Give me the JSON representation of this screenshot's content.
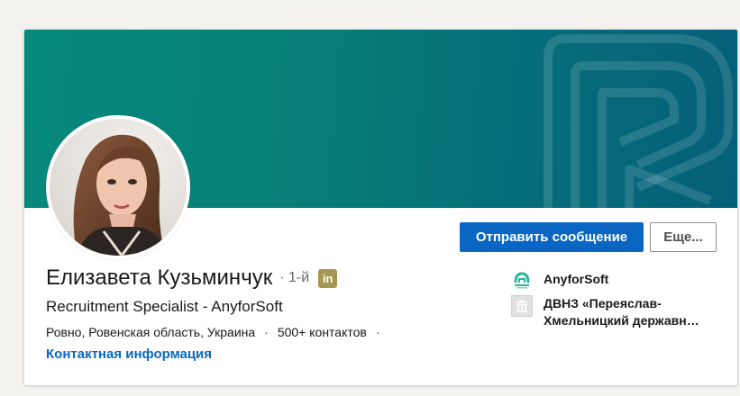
{
  "profile": {
    "name": "Елизавета Кузьминчук",
    "degree_separator": "·",
    "degree": "1-й",
    "badge_icon": "linkedin-icon",
    "badge_text": "in",
    "headline": "Recruitment Specialist - AnyforSoft",
    "location": "Ровно, Ровенская область, Украина",
    "sep1": "·",
    "connections": "500+ контактов",
    "sep2": "·",
    "contact_info_label": "Контактная информация"
  },
  "actions": {
    "message_label": "Отправить сообщение",
    "more_label": "Еще..."
  },
  "sidebar": {
    "company_name": "AnyforSoft",
    "company_icon": "anyforsoft-logo-icon",
    "school_line1": "ДВНЗ «Переяслав-",
    "school_line2": "Хмельницкий державн…",
    "school_icon": "school-building-icon"
  },
  "colors": {
    "banner_start": "#07897c",
    "banner_end": "#055f79",
    "primary": "#0a66c2",
    "badge": "#a69654",
    "page_bg": "#f3f2ef"
  }
}
